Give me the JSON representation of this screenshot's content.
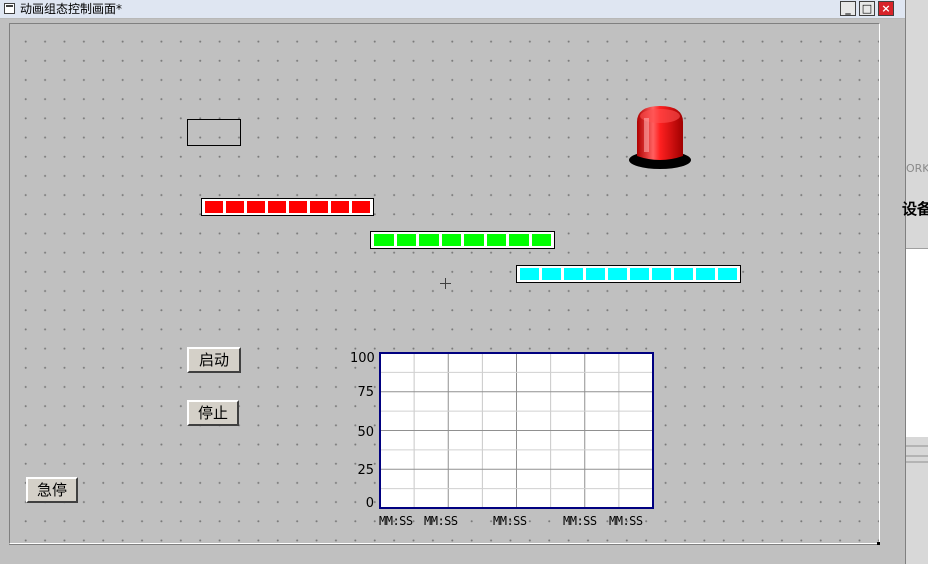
{
  "window": {
    "title": "动画组态控制画面*",
    "buttons": {
      "minimize": "_",
      "maximize": "□",
      "close": "×"
    }
  },
  "colors": {
    "canvas_bg": "#c0c0c0",
    "bar_red": "#ff0000",
    "bar_green": "#00ff00",
    "bar_cyan": "#00ffff",
    "lamp_red": "#ff1a1a",
    "chart_border": "#000080"
  },
  "bars": {
    "red": {
      "segments": 8
    },
    "green": {
      "segments": 8
    },
    "cyan": {
      "segments": 10
    }
  },
  "controls": {
    "start_label": "启动",
    "stop_label": "停止",
    "estop_label": "急停"
  },
  "trend": {
    "y_ticks": [
      "100",
      "75",
      "50",
      "25",
      "0"
    ],
    "x_ticks": [
      "MM:SS",
      "MM:SS",
      "MM:SS",
      "MM:SS",
      "MM:SS"
    ]
  },
  "chart_data": {
    "type": "line",
    "title": "",
    "xlabel": "",
    "ylabel": "",
    "ylim": [
      0,
      100
    ],
    "y_ticks": [
      0,
      25,
      50,
      75,
      100
    ],
    "x_tick_labels": [
      "MM:SS",
      "MM:SS",
      "MM:SS",
      "MM:SS",
      "MM:SS"
    ],
    "series": [],
    "grid": true
  },
  "side_panel": {
    "text_top": "ORK",
    "text_bold": "设备"
  }
}
